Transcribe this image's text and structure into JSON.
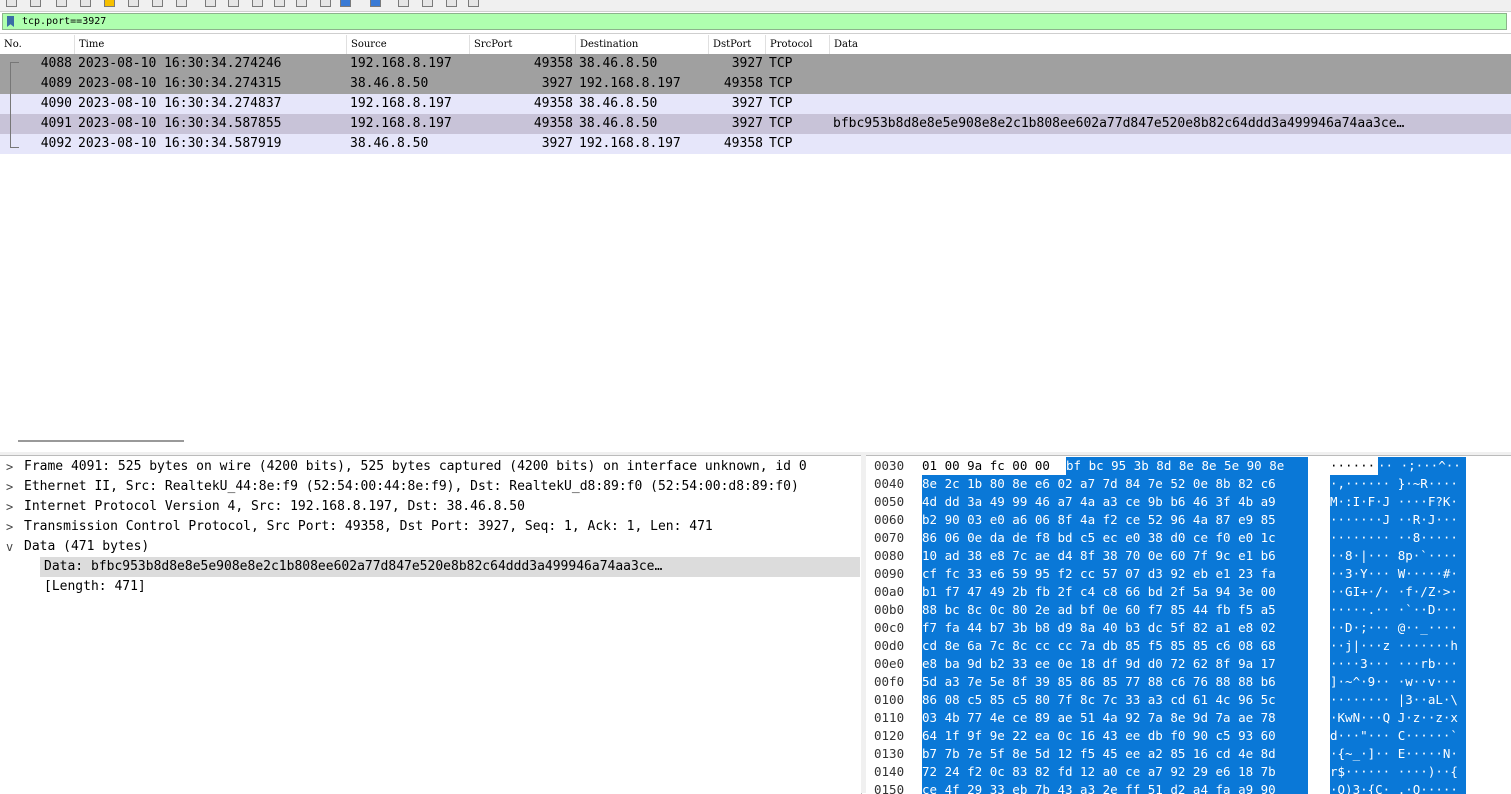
{
  "filter": {
    "value": "tcp.port==3927"
  },
  "columns": [
    "No.",
    "Time",
    "Source",
    "SrcPort",
    "Destination",
    "DstPort",
    "Protocol",
    "Data"
  ],
  "packets": [
    {
      "no": "4088",
      "time": "2023-08-10 16:30:34.274246",
      "src": "192.168.8.197",
      "srcport": "49358",
      "dst": "38.46.8.50",
      "dstport": "3927",
      "proto": "TCP",
      "data": ""
    },
    {
      "no": "4089",
      "time": "2023-08-10 16:30:34.274315",
      "src": "38.46.8.50",
      "srcport": "3927",
      "dst": "192.168.8.197",
      "dstport": "49358",
      "proto": "TCP",
      "data": ""
    },
    {
      "no": "4090",
      "time": "2023-08-10 16:30:34.274837",
      "src": "192.168.8.197",
      "srcport": "49358",
      "dst": "38.46.8.50",
      "dstport": "3927",
      "proto": "TCP",
      "data": ""
    },
    {
      "no": "4091",
      "time": "2023-08-10 16:30:34.587855",
      "src": "192.168.8.197",
      "srcport": "49358",
      "dst": "38.46.8.50",
      "dstport": "3927",
      "proto": "TCP",
      "data": "bfbc953b8d8e8e5e908e8e2c1b808ee602a77d847e520e8b82c64ddd3a499946a74aa3ce…"
    },
    {
      "no": "4092",
      "time": "2023-08-10 16:30:34.587919",
      "src": "38.46.8.50",
      "srcport": "3927",
      "dst": "192.168.8.197",
      "dstport": "49358",
      "proto": "TCP",
      "data": ""
    }
  ],
  "details": [
    {
      "arrow": ">",
      "text": "Frame 4091: 525 bytes on wire (4200 bits), 525 bytes captured (4200 bits) on interface unknown, id 0"
    },
    {
      "arrow": ">",
      "text": "Ethernet II, Src: RealtekU_44:8e:f9 (52:54:00:44:8e:f9), Dst: RealtekU_d8:89:f0 (52:54:00:d8:89:f0)"
    },
    {
      "arrow": ">",
      "text": "Internet Protocol Version 4, Src: 192.168.8.197, Dst: 38.46.8.50"
    },
    {
      "arrow": ">",
      "text": "Transmission Control Protocol, Src Port: 49358, Dst Port: 3927, Seq: 1, Ack: 1, Len: 471"
    },
    {
      "arrow": "v",
      "text": "Data (471 bytes)"
    },
    {
      "arrow": "",
      "text": "Data: bfbc953b8d8e8e5e908e8e2c1b808ee602a77d847e520e8b82c64ddd3a499946a74aa3ce…"
    },
    {
      "arrow": "",
      "text": "[Length: 471]"
    }
  ],
  "bytes": [
    {
      "off": "0030",
      "pre": "01 00 9a fc 00 00 ",
      "hex": "bf bc  95 3b 8d 8e 8e 5e 90 8e",
      "ascii_pre": "······",
      "ascii": "·· ·;···^··"
    },
    {
      "off": "0040",
      "pre": "",
      "hex": "8e 2c 1b 80 8e e6 02 a7  7d 84 7e 52 0e 8b 82 c6",
      "ascii_pre": "",
      "ascii": "·,······ }·~R····"
    },
    {
      "off": "0050",
      "pre": "",
      "hex": "4d dd 3a 49 99 46 a7 4a  a3 ce 9b b6 46 3f 4b a9",
      "ascii_pre": "",
      "ascii": "M·:I·F·J ····F?K·"
    },
    {
      "off": "0060",
      "pre": "",
      "hex": "b2 90 03 e0 a6 06 8f 4a  f2 ce 52 96 4a 87 e9 85",
      "ascii_pre": "",
      "ascii": "·······J ··R·J···"
    },
    {
      "off": "0070",
      "pre": "",
      "hex": "86 06 0e da de f8 bd c5  ec e0 38 d0 ce f0 e0 1c",
      "ascii_pre": "",
      "ascii": "········ ··8·····"
    },
    {
      "off": "0080",
      "pre": "",
      "hex": "10 ad 38 e8 7c ae d4 8f  38 70 0e 60 7f 9c e1 b6",
      "ascii_pre": "",
      "ascii": "··8·|··· 8p·`····"
    },
    {
      "off": "0090",
      "pre": "",
      "hex": "cf fc 33 e6 59 95 f2 cc  57 07 d3 92 eb e1 23 fa",
      "ascii_pre": "",
      "ascii": "··3·Y··· W·····#·"
    },
    {
      "off": "00a0",
      "pre": "",
      "hex": "b1 f7 47 49 2b fb 2f c4  c8 66 bd 2f 5a 94 3e 00",
      "ascii_pre": "",
      "ascii": "··GI+·/· ·f·/Z·>·"
    },
    {
      "off": "00b0",
      "pre": "",
      "hex": "88 bc 8c 0c 80 2e ad bf  0e 60 f7 85 44 fb f5 a5",
      "ascii_pre": "",
      "ascii": "·····.·· ·`··D···"
    },
    {
      "off": "00c0",
      "pre": "",
      "hex": "f7 fa 44 b7 3b b8 d9 8a  40 b3 dc 5f 82 a1 e8 02",
      "ascii_pre": "",
      "ascii": "··D·;··· @··_····"
    },
    {
      "off": "00d0",
      "pre": "",
      "hex": "cd 8e 6a 7c 8c cc cc 7a  db 85 f5 85 85 c6 08 68",
      "ascii_pre": "",
      "ascii": "··j|···z ·······h"
    },
    {
      "off": "00e0",
      "pre": "",
      "hex": "e8 ba 9d b2 33 ee 0e 18  df 9d d0 72 62 8f 9a 17",
      "ascii_pre": "",
      "ascii": "····3··· ···rb···"
    },
    {
      "off": "00f0",
      "pre": "",
      "hex": "5d a3 7e 5e 8f 39 85 86  85 77 88 c6 76 88 88 b6",
      "ascii_pre": "",
      "ascii": "]·~^·9·· ·w··v···"
    },
    {
      "off": "0100",
      "pre": "",
      "hex": "86 08 c5 85 c5 80 7f 8c  7c 33 a3 cd 61 4c 96 5c",
      "ascii_pre": "",
      "ascii": "········ |3··aL·\\"
    },
    {
      "off": "0110",
      "pre": "",
      "hex": "03 4b 77 4e ce 89 ae 51  4a 92 7a 8e 9d 7a ae 78",
      "ascii_pre": "",
      "ascii": "·KwN···Q J·z··z·x"
    },
    {
      "off": "0120",
      "pre": "",
      "hex": "64 1f 9f 9e 22 ea 0c 16  43 ee db f0 90 c5 93 60",
      "ascii_pre": "",
      "ascii": "d···\"··· C······`"
    },
    {
      "off": "0130",
      "pre": "",
      "hex": "b7 7b 7e 5f 8e 5d 12 f5  45 ee a2 85 16 cd 4e 8d",
      "ascii_pre": "",
      "ascii": "·{~_·]·· E·····N·"
    },
    {
      "off": "0140",
      "pre": "",
      "hex": "72 24 f2 0c 83 82 fd 12  a0 ce a7 92 29 e6 18 7b",
      "ascii_pre": "",
      "ascii": "r$······ ····)··{"
    },
    {
      "off": "0150",
      "pre": "",
      "hex": "ce 4f 29 33 eb 7b 43 a3  2e ff 51 d2 a4 fa a9 90",
      "ascii_pre": "",
      "ascii": "·O)3·{C· .·Q·····"
    }
  ]
}
